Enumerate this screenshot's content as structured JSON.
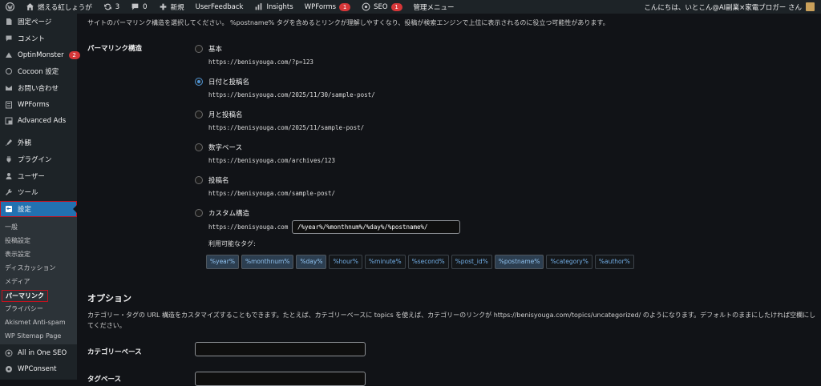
{
  "adminbar": {
    "site_name": "燃える紅しょうが",
    "updates_count": "3",
    "comments_count": "0",
    "new_label": "新規",
    "user_feedback": "UserFeedback",
    "insights": "Insights",
    "wpforms": "WPForms",
    "wpforms_badge": "1",
    "seo": "SEO",
    "seo_badge": "1",
    "admin_menu": "管理メニュー",
    "greeting": "こんにちは、いとこん@AI副業×家電ブロガー さん"
  },
  "sidebar": {
    "items_top": [
      {
        "label": "固定ページ",
        "icon": "page-icon"
      },
      {
        "label": "コメント",
        "icon": "comment-icon"
      },
      {
        "label": "OptinMonster",
        "icon": "optinmonster-icon",
        "badge": "2"
      },
      {
        "label": "Cocoon 設定",
        "icon": "cocoon-icon"
      },
      {
        "label": "お問い合わせ",
        "icon": "mail-icon"
      },
      {
        "label": "WPForms",
        "icon": "wpforms-icon"
      },
      {
        "label": "Advanced Ads",
        "icon": "ads-icon"
      },
      {
        "label": "外観",
        "icon": "appearance-icon"
      },
      {
        "label": "プラグイン",
        "icon": "plugin-icon"
      },
      {
        "label": "ユーザー",
        "icon": "user-icon"
      },
      {
        "label": "ツール",
        "icon": "tool-icon"
      }
    ],
    "settings_label": "設定",
    "sub_items": [
      "一般",
      "投稿設定",
      "表示設定",
      "ディスカッション",
      "メディア",
      "パーマリンク",
      "プライバシー",
      "Akismet Anti-spam",
      "WP Sitemap Page"
    ],
    "items_bottom": [
      {
        "label": "All in One SEO",
        "icon": "aioseo-icon"
      },
      {
        "label": "WPConsent",
        "icon": "wpconsent-icon"
      }
    ]
  },
  "content": {
    "intro": "サイトのパーマリンク構造を選択してください。 %postname% タグを含めるとリンクが理解しやすくなり、投稿が検索エンジンで上位に表示されるのに役立つ可能性があります。",
    "structure_label": "パーマリンク構造",
    "options": [
      {
        "label": "基本",
        "url": "https://benisyouga.com/?p=123",
        "checked": false
      },
      {
        "label": "日付と投稿名",
        "url": "https://benisyouga.com/2025/11/30/sample-post/",
        "checked": true
      },
      {
        "label": "月と投稿名",
        "url": "https://benisyouga.com/2025/11/sample-post/",
        "checked": false
      },
      {
        "label": "数字ベース",
        "url": "https://benisyouga.com/archives/123",
        "checked": false
      },
      {
        "label": "投稿名",
        "url": "https://benisyouga.com/sample-post/",
        "checked": false
      },
      {
        "label": "カスタム構造",
        "url": "",
        "checked": false
      }
    ],
    "custom_prefix": "https://benisyouga.com",
    "custom_value": "/%year%/%monthnum%/%day%/%postname%/",
    "available_tags_label": "利用可能なタグ:",
    "tags": [
      {
        "label": "%year%",
        "active": true
      },
      {
        "label": "%monthnum%",
        "active": true
      },
      {
        "label": "%day%",
        "active": true
      },
      {
        "label": "%hour%",
        "active": false
      },
      {
        "label": "%minute%",
        "active": false
      },
      {
        "label": "%second%",
        "active": false
      },
      {
        "label": "%post_id%",
        "active": false
      },
      {
        "label": "%postname%",
        "active": true
      },
      {
        "label": "%category%",
        "active": false
      },
      {
        "label": "%author%",
        "active": false
      }
    ],
    "options_heading": "オプション",
    "options_desc": "カテゴリー・タグの URL 構造をカスタマイズすることもできます。たとえば、カテゴリーベースに topics を使えば、カテゴリーのリンクが https://benisyouga.com/topics/uncategorized/ のようになります。デフォルトのままにしたければ空欄にしてください。",
    "category_base_label": "カテゴリーベース",
    "category_base_value": "",
    "tag_base_label": "タグベース",
    "tag_base_value": ""
  },
  "colors": {
    "accent": "#2271b1",
    "highlight_border": "#c1121f",
    "badge": "#d63638",
    "tag_link": "#72aee6"
  }
}
